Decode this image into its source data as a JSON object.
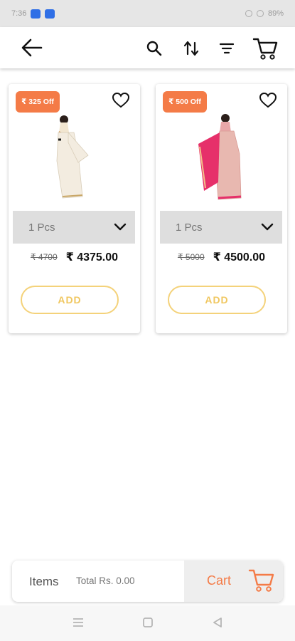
{
  "status_bar": {
    "time": "7:36",
    "right_text": "89%"
  },
  "header": {
    "back_icon": "arrow-left-icon",
    "search_icon": "search-icon",
    "sort_icon": "sort-icon",
    "filter_icon": "filter-icon",
    "cart_icon": "cart-icon"
  },
  "products": [
    {
      "discount": "₹ 325 Off",
      "qty_label": "1  Pcs",
      "mrp": "₹ 4700",
      "price": "₹ 4375.00",
      "add_label": "ADD",
      "saree_color": "#f3ece0",
      "border_color": "#c9a767"
    },
    {
      "discount": "₹ 500 Off",
      "qty_label": "1  Pcs",
      "mrp": "₹ 5000",
      "price": "₹ 4500.00",
      "add_label": "ADD",
      "saree_color": "#e8a7a8",
      "border_color": "#e6306a"
    }
  ],
  "bottom_bar": {
    "items_label": "Items",
    "total_label": "Total Rs. 0.00",
    "cart_label": "Cart"
  },
  "colors": {
    "accent": "#f47b47",
    "add_border": "#f4d27a",
    "add_text": "#f0c760"
  }
}
